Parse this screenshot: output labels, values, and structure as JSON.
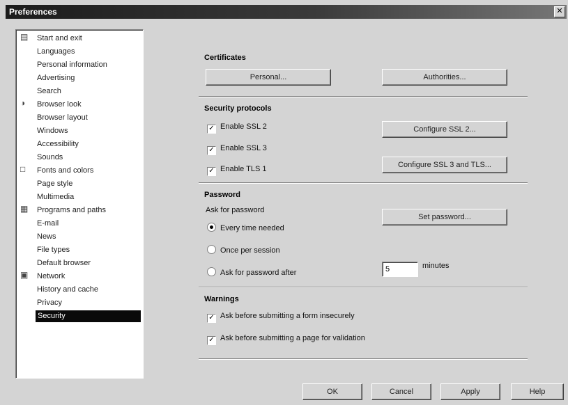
{
  "window": {
    "title": "Preferences",
    "close": "✕"
  },
  "tree": {
    "groups": [
      {
        "label": "Start and exit",
        "icon": "document-icon"
      },
      {
        "label": "Browser look",
        "icon": "eye-icon"
      },
      {
        "label": "Fonts and colors",
        "icon": "font-icon"
      },
      {
        "label": "Programs and paths",
        "icon": "program-icon"
      },
      {
        "label": "Network",
        "icon": "network-icon"
      }
    ],
    "items": [
      "Start and exit",
      "Languages",
      "Personal information",
      "Advertising",
      "Search",
      "Browser look",
      "Browser layout",
      "Windows",
      "Accessibility",
      "Sounds",
      "Fonts and colors",
      "Page style",
      "Multimedia",
      "Programs and paths",
      "E-mail",
      "News",
      "File types",
      "Default browser",
      "Network",
      "History and cache",
      "Privacy",
      "Security"
    ],
    "selected": "Security"
  },
  "certificates": {
    "title": "Certificates",
    "personal": "Personal...",
    "authorities": "Authorities..."
  },
  "protocols": {
    "title": "Security protocols",
    "ssl2": {
      "label": "Enable SSL 2",
      "checked": true
    },
    "ssl3": {
      "label": "Enable SSL 3",
      "checked": true
    },
    "tls1": {
      "label": "Enable TLS 1",
      "checked": true
    },
    "configure_ssl2": "Configure SSL 2...",
    "configure_ssl3_tls": "Configure SSL 3 and TLS..."
  },
  "password": {
    "title": "Password",
    "ask_label": "Ask for password",
    "every_time": "Every time needed",
    "once_per_session": "Once per session",
    "ask_after": "Ask for password after",
    "minutes_value": "5",
    "minutes_label": "minutes",
    "set_password": "Set password...",
    "selected": "every_time"
  },
  "warnings": {
    "title": "Warnings",
    "insecure_form": {
      "label": "Ask before submitting a form insecurely",
      "checked": true
    },
    "validation": {
      "label": "Ask before submitting a page for validation",
      "checked": true
    }
  },
  "footer": {
    "ok": "OK",
    "cancel": "Cancel",
    "apply": "Apply",
    "help": "Help"
  },
  "glyphs": {
    "check": "✓"
  }
}
